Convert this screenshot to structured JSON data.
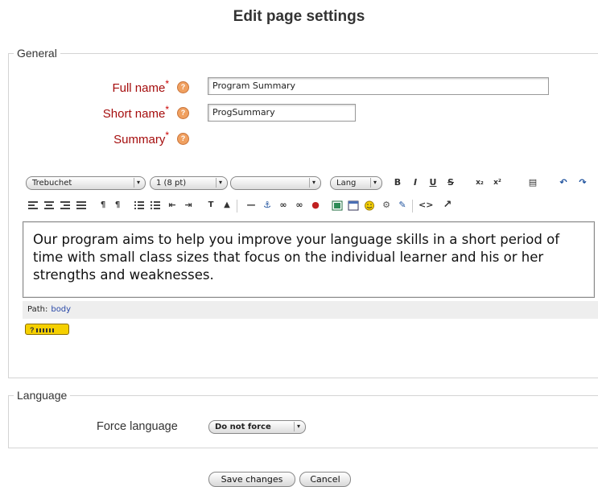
{
  "page": {
    "title": "Edit page settings"
  },
  "general": {
    "legend": "General",
    "fields": [
      {
        "label": "Full name",
        "value": "Program Summary"
      },
      {
        "label": "Short name",
        "value": "ProgSummary"
      },
      {
        "label": "Summary"
      }
    ],
    "required_mark": "*"
  },
  "editor": {
    "font_family": "Trebuchet",
    "font_size": "1 (8 pt)",
    "format": "",
    "lang": "Lang",
    "content": "Our program aims to help you improve your language skills in a short period of time with small class sizes that focus on the individual learner and his or her strengths and weaknesses.",
    "path_label": "Path:",
    "path_value": "body",
    "help_badge": "?"
  },
  "language": {
    "legend": "Language",
    "force_label": "Force language",
    "force_value": "Do not force"
  },
  "buttons": {
    "save": "Save changes",
    "cancel": "Cancel"
  }
}
